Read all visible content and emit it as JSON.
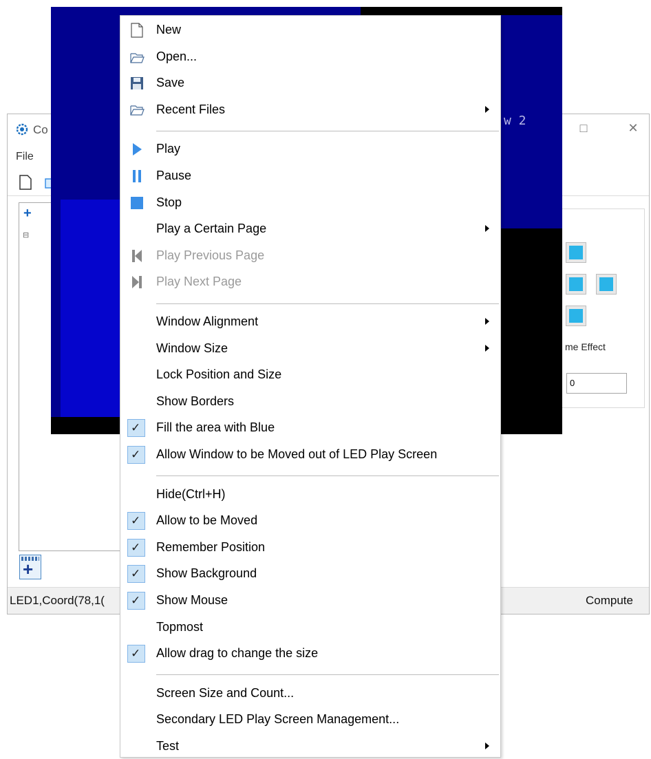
{
  "app": {
    "title": "Co",
    "menu_file": "File",
    "menu_second": "(",
    "minimize_glyph": "—",
    "maximize_glyph": "□",
    "close_glyph": "✕",
    "icon": "gear-icon"
  },
  "led_window": {
    "label": "w 2",
    "colors": {
      "background": "#000000",
      "fill": "#01018f",
      "highlight": "#0505cc"
    }
  },
  "right_panel": {
    "frame_effect_label": "me Effect",
    "frame_effect_value": "0"
  },
  "statusbar": {
    "left_text": "LED1,Coord(78,1(",
    "right_text": "Compute"
  },
  "context_menu": {
    "sections": [
      [
        {
          "label": "New",
          "icon": "new-file-icon"
        },
        {
          "label": "Open...",
          "icon": "open-folder-icon"
        },
        {
          "label": "Save",
          "icon": "save-disk-icon"
        },
        {
          "label": "Recent Files",
          "icon": "recent-folder-icon",
          "submenu": true
        }
      ],
      [
        {
          "label": "Play",
          "icon": "play-icon"
        },
        {
          "label": "Pause",
          "icon": "pause-icon"
        },
        {
          "label": "Stop",
          "icon": "stop-icon"
        },
        {
          "label": "Play a Certain Page",
          "submenu": true
        },
        {
          "label": "Play Previous Page",
          "icon": "previous-page-icon",
          "disabled": true
        },
        {
          "label": "Play Next Page",
          "icon": "next-page-icon",
          "disabled": true
        }
      ],
      [
        {
          "label": "Window Alignment",
          "submenu": true
        },
        {
          "label": "Window Size",
          "submenu": true
        },
        {
          "label": "Lock Position and Size"
        },
        {
          "label": "Show Borders"
        },
        {
          "label": "Fill the area with Blue",
          "checked": true
        },
        {
          "label": "Allow Window to be Moved out of LED Play Screen",
          "checked": true
        }
      ],
      [
        {
          "label": "Hide(Ctrl+H)"
        },
        {
          "label": "Allow to be Moved",
          "checked": true
        },
        {
          "label": "Remember Position",
          "checked": true
        },
        {
          "label": "Show Background",
          "checked": true
        },
        {
          "label": "Show Mouse",
          "checked": true
        },
        {
          "label": "Topmost"
        },
        {
          "label": "Allow drag to change the size",
          "checked": true
        }
      ],
      [
        {
          "label": "Screen Size and Count..."
        },
        {
          "label": "Secondary LED Play Screen Management..."
        },
        {
          "label": "Test",
          "submenu": true
        }
      ]
    ],
    "check_glyph": "✓",
    "colors": {
      "icon_blue": "#3a8ee6",
      "check_bg": "#cce4f7",
      "disabled_text": "#9a9a9a"
    }
  }
}
